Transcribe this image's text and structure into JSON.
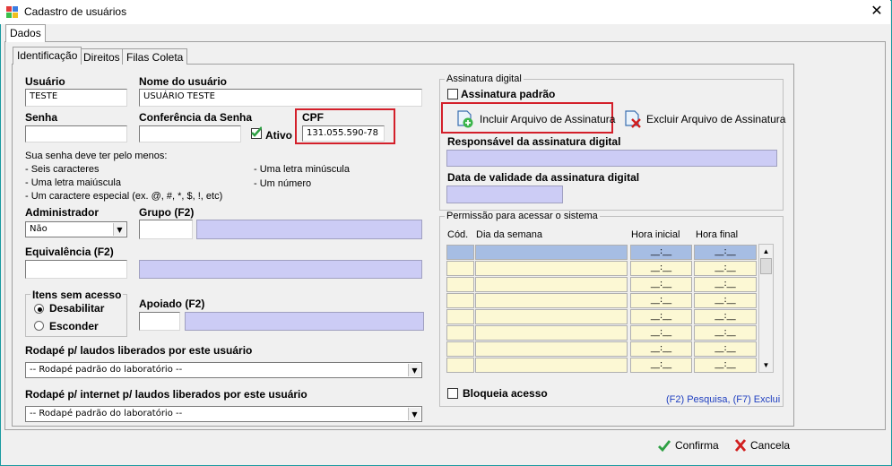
{
  "window": {
    "title": "Cadastro de usuários",
    "close_glyph": "✕",
    "icon": "app-grid-icon"
  },
  "outer_tabs": [
    "Dados"
  ],
  "inner_tabs": [
    "Identificação",
    "Direitos",
    "Filas Coleta"
  ],
  "form": {
    "usuario_label": "Usuário",
    "usuario_value": "TESTE",
    "nome_label": "Nome do usuário",
    "nome_value": "USUÁRIO TESTE",
    "senha_label": "Senha",
    "conf_senha_label": "Conferência da Senha",
    "ativo_label": "Ativo",
    "cpf_label": "CPF",
    "cpf_value": "131.055.590-78",
    "rules_title": "Sua senha deve ter pelo menos:",
    "rules_left": [
      "- Seis caracteres",
      "- Uma letra maiúscula",
      "- Um caractere especial  (ex. @, #, *, $, !, etc)"
    ],
    "rules_right": [
      "- Uma letra minúscula",
      "- Um número"
    ],
    "admin_label": "Administrador",
    "admin_value": "Não",
    "grupo_label": "Grupo (F2)",
    "equiv_label": "Equivalência (F2)",
    "itens_title": "Itens sem acesso",
    "radio_desabilitar": "Desabilitar",
    "radio_esconder": "Esconder",
    "apoiado_label": "Apoiado (F2)",
    "rodape_label": "Rodapé p/ laudos liberados por este usuário",
    "rodape_value": "-- Rodapé padrão do laboratório --",
    "rodape_internet_label": "Rodapé p/ internet p/ laudos liberados por este usuário",
    "rodape_internet_value": "-- Rodapé padrão do laboratório --"
  },
  "assinatura": {
    "group_title": "Assinatura digital",
    "padrao_label": "Assinatura padrão",
    "incluir_label": "Incluir Arquivo de Assinatura",
    "excluir_label": "Excluir Arquivo de Assinatura",
    "responsavel_label": "Responsável da assinatura digital",
    "validade_label": "Data de validade da assinatura digital"
  },
  "permissao": {
    "group_title": "Permissão para acessar o sistema",
    "headers": [
      "Cód.",
      "Dia da semana",
      "Hora inicial",
      "Hora final"
    ],
    "time_placeholder": "__:__",
    "row_count": 8,
    "bloqueia_label": "Bloqueia acesso",
    "hint": "(F2) Pesquisa, (F7) Exclui"
  },
  "footer": {
    "confirma_label": "Confirma",
    "cancela_label": "Cancela"
  },
  "colors": {
    "highlight_red": "#d31f2a",
    "lavender": "#ccccf5",
    "grid_yellow": "#fcf8d4",
    "grid_selected": "#a6bde3",
    "confirm_green": "#2ea043",
    "cancel_red": "#d11f1f"
  }
}
